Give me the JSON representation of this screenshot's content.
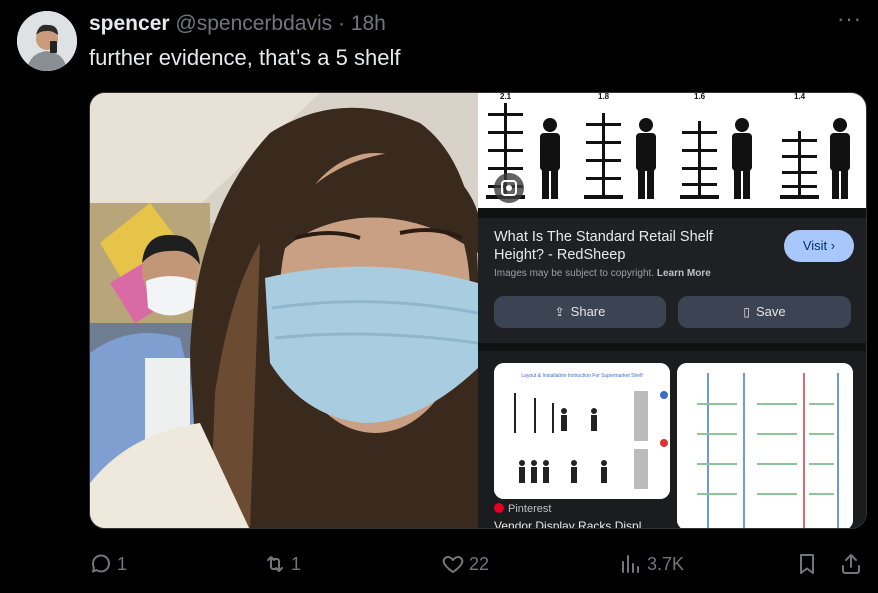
{
  "tweet": {
    "author_name": "spencer",
    "handle": "@spencerbdavis",
    "separator": "·",
    "time": "18h",
    "text": "further evidence, that’s a 5 shelf",
    "more_label": "···"
  },
  "media": {
    "search_card": {
      "title": "What Is The Standard Retail Shelf Height? - RedSheep",
      "disclaimer": "Images may be subject to copyright.",
      "learn_more": "Learn More",
      "visit_label": "Visit",
      "share_label": "Share",
      "save_label": "Save",
      "shelf_heights": [
        "2.1",
        "1.8",
        "1.6",
        "1.4"
      ]
    },
    "related": {
      "thumb1_title": "Layout & Installation Instruction For Supermarket Shelf",
      "source": "Pinterest",
      "title": "Vendor Display Racks Displ..."
    }
  },
  "actions": {
    "replies": "1",
    "reposts": "1",
    "likes": "22",
    "views": "3.7K"
  },
  "colors": {
    "background": "#000000",
    "text": "#e7e9ea",
    "muted": "#71767b",
    "visit_button": "#a8c7fa"
  }
}
